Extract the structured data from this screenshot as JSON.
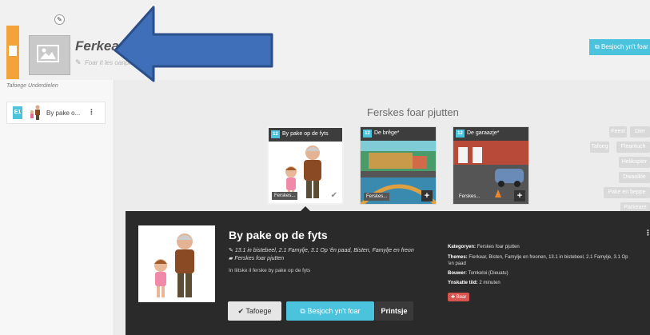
{
  "header": {
    "lesson_title": "Ferkear",
    "lesson_subtitle": "Foar it les oanpassen",
    "view_button": "Besjoch yn't foar"
  },
  "sidebar": {
    "label": "Tafoege Underdielen",
    "item": {
      "badge": "E1",
      "label": "By pake o..."
    }
  },
  "main": {
    "section_title": "Ferskes foar pjutten",
    "cards": [
      {
        "num": "12",
        "title": "By pake op de fyts",
        "tag": "Ferskes..."
      },
      {
        "num": "12",
        "title": "De brêge*",
        "tag": "Ferskes..."
      },
      {
        "num": "12",
        "title": "De garaazje*",
        "tag": "Ferskes..."
      }
    ],
    "filters": [
      "Feest",
      "Dier",
      "Tafoeg",
      "Fleantuch",
      "Helikopter",
      "Dwaalkle",
      "Pake en beppe",
      "Parkeare"
    ]
  },
  "detail": {
    "title": "By pake op de fyts",
    "meta1": "13.1 in bistebeel, 2.1 Famylje, 3.1 Op 'ên paad, Bisten, Famylje en freon",
    "meta2": "Ferskes foar pjutten",
    "description": "In liitske il ferske by pake op de fyts",
    "info_category_label": "Kategoryen:",
    "info_category": "Ferskes foar pjutten",
    "info_themes_label": "Themes:",
    "info_themes": "Fierkear, Bisten, Famylje en freonen, 13.1 in bistebeel, 2.1 Famylje, 3.1 Op",
    "info_themes2": "'en paad",
    "info_bouwer_label": "Bouwer:",
    "info_bouwer": "Tomkeloi (Dieuatu)",
    "info_time_label": "Ynskatte tiid:",
    "info_time": "2 minuten",
    "badge": "Bear",
    "buttons": {
      "add": "Tafoege",
      "view": "Besjoch yn't foar",
      "print": "Printsje"
    }
  },
  "colors": {
    "accent": "#4cc3dd",
    "orange": "#f2a33a",
    "arrow": "#3f6fb8",
    "panel": "#2a2a2a"
  }
}
